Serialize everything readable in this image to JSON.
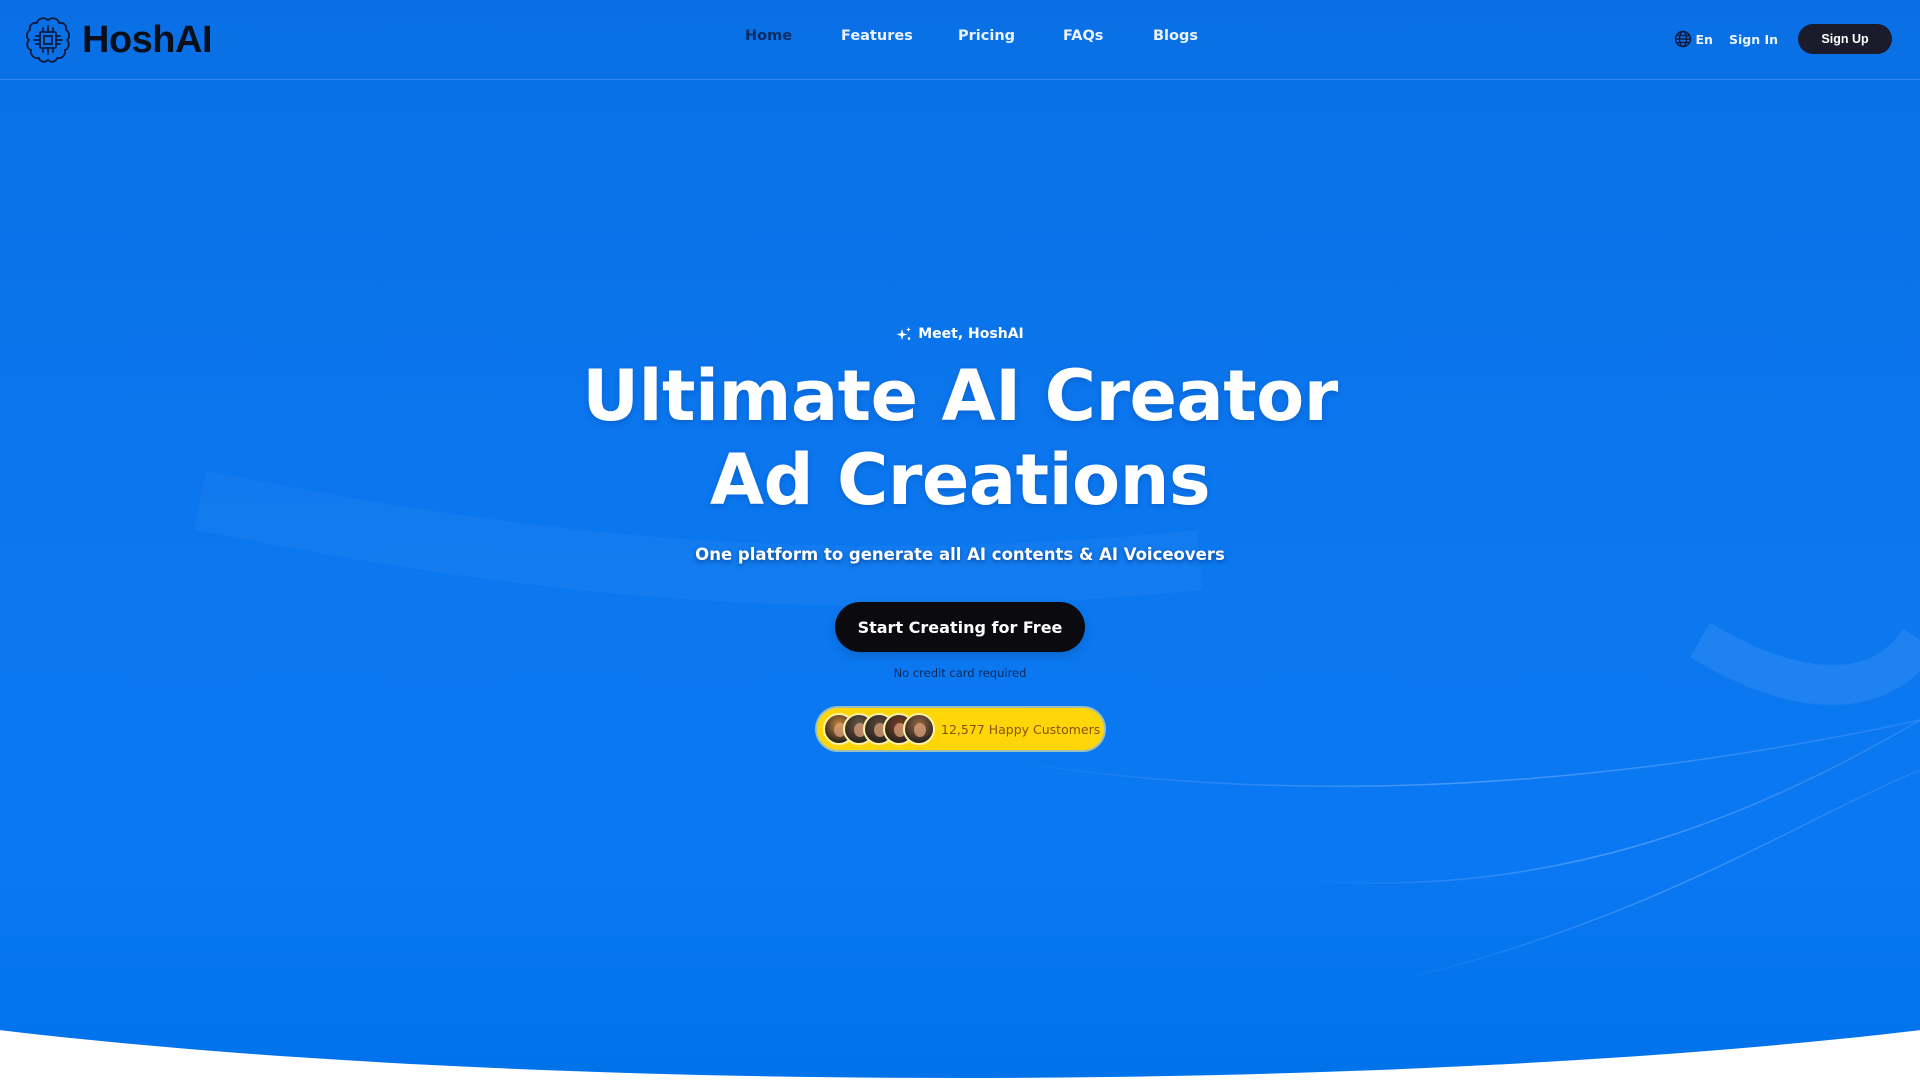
{
  "brand": {
    "name": "HoshAI",
    "logo_icon": "brain-chip-icon"
  },
  "nav": {
    "items": [
      {
        "label": "Home",
        "active": true
      },
      {
        "label": "Features",
        "active": false
      },
      {
        "label": "Pricing",
        "active": false
      },
      {
        "label": "FAQs",
        "active": false
      },
      {
        "label": "Blogs",
        "active": false
      }
    ],
    "language": {
      "icon": "globe-icon",
      "label": "En"
    },
    "sign_in": "Sign In",
    "sign_up": "Sign Up"
  },
  "hero": {
    "eyebrow": {
      "icon": "sparkle-icon",
      "text": "Meet, HoshAI"
    },
    "headline_line1": "Ultimate AI Creator",
    "headline_line2": "Ad Creations",
    "subheadline": "One platform to generate all AI contents & AI Voiceovers",
    "cta_label": "Start Creating for Free",
    "cta_note": "No credit card required",
    "social_proof": {
      "avatars": [
        {
          "name": "customer-avatar-1",
          "tone": "#c9873f"
        },
        {
          "name": "customer-avatar-2",
          "tone": "#6b5a4a"
        },
        {
          "name": "customer-avatar-3",
          "tone": "#5a4a40"
        },
        {
          "name": "customer-avatar-4",
          "tone": "#7a3f2a"
        },
        {
          "name": "customer-avatar-5",
          "tone": "#9a6a4a"
        }
      ],
      "text": "12,577 Happy Customers"
    }
  },
  "colors": {
    "primary_blue": "#0a78f0",
    "active_nav": "#0a2d66",
    "cta_bg": "#0a0a0f",
    "badge_yellow": "#ffd60a",
    "badge_text": "#8a5200"
  }
}
